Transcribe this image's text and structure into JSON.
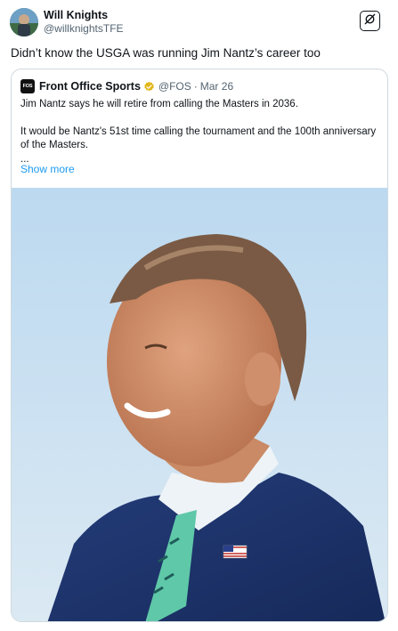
{
  "author": {
    "display_name": "Will Knights",
    "handle": "@willknightsTFE"
  },
  "tweet": {
    "text": "Didn’t know the USGA was running Jim Nantz’s career too"
  },
  "quoted": {
    "logo_text": "FOS",
    "display_name": "Front Office Sports",
    "handle": "@FOS",
    "separator": "·",
    "date": "Mar 26",
    "lines": [
      "Jim Nantz says he will retire from calling the Masters in 2036.",
      "It would be Nantz's 51st time calling the tournament and the 100th anniversary of the Masters.",
      "..."
    ],
    "show_more": "Show more"
  },
  "icons": {
    "grok": "grok-icon",
    "verified": "verified-badge-icon"
  },
  "colors": {
    "text": "#0f1419",
    "secondary": "#536471",
    "link": "#1d9bf0",
    "border": "#cfd9de",
    "verified_gold": "#e2b719"
  }
}
